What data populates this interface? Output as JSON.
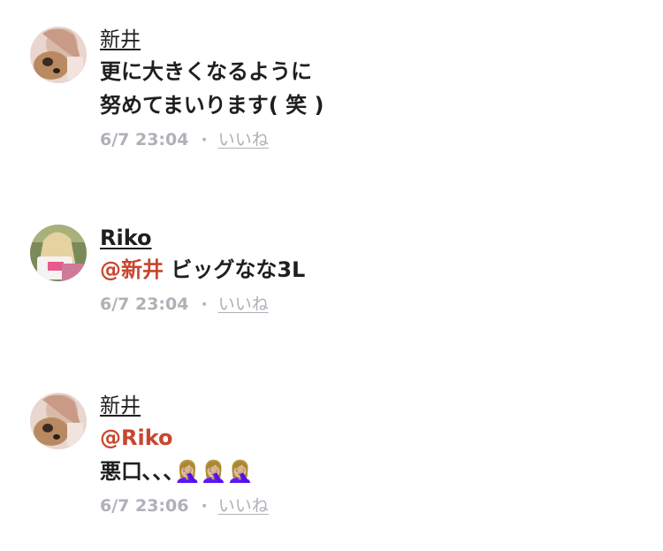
{
  "comments": [
    {
      "user": "新井",
      "lines": [
        "更に大きくなるように",
        "努めてまいります( 笑 )"
      ],
      "time": "6/7 23:04",
      "like": "いいね",
      "separator": "·"
    },
    {
      "user": "Riko",
      "mention": "@新井",
      "text": " ビッグなな3L",
      "time": "6/7 23:04",
      "like": "いいね",
      "separator": "·"
    },
    {
      "user": "新井",
      "mention": "@Riko",
      "text": "悪口､､､",
      "emoji": "🤦🏼‍♀️🤦🏼‍♀️🤦🏼‍♀️",
      "time": "6/7 23:06",
      "like": "いいね",
      "separator": "·"
    }
  ],
  "colors": {
    "mention": "#c8462e",
    "meta": "#b0b0b8",
    "text": "#1f1f1f"
  }
}
